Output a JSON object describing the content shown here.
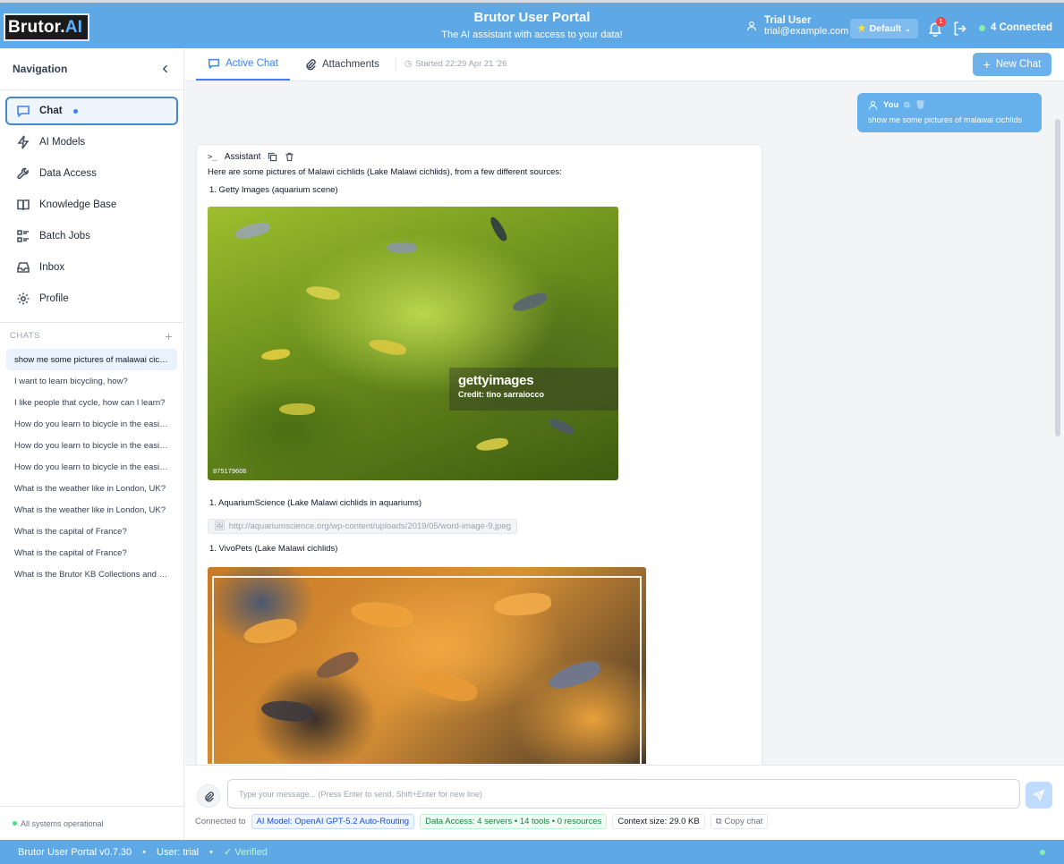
{
  "header": {
    "logo_text": "Brutor.",
    "logo_accent": "AI",
    "title": "Brutor User Portal",
    "subtitle": "The AI assistant with access to your data!",
    "user_name": "Trial User",
    "user_email": "trial@example.com",
    "preset_label": "Default",
    "notification_count": "1",
    "connected_label": "4 Connected"
  },
  "sidebar": {
    "title": "Navigation",
    "nav": [
      {
        "label": "Chat",
        "icon": "chat-icon"
      },
      {
        "label": "AI Models",
        "icon": "bolt-icon"
      },
      {
        "label": "Data Access",
        "icon": "wrench-icon"
      },
      {
        "label": "Knowledge Base",
        "icon": "book-icon"
      },
      {
        "label": "Batch Jobs",
        "icon": "list-icon"
      },
      {
        "label": "Inbox",
        "icon": "inbox-icon"
      },
      {
        "label": "Profile",
        "icon": "gear-icon"
      }
    ],
    "chats_heading": "CHATS",
    "chats": [
      "show me some pictures of malawai cichlids",
      "I want to learn bicycling, how?",
      "I like people that cycle, how can I learn?",
      "How do you learn to bicycle in the easiest way?",
      "How do you learn to bicycle in the easiest way?",
      "How do you learn to bicycle in the easiest way?",
      "What is the weather like in London, UK?",
      "What is the weather like in London, UK?",
      "What is the capital of France?",
      "What is the capital of France?",
      "What is the Brutor KB Collections and Knowledge?"
    ],
    "status_text": "All systems operational"
  },
  "tabs": {
    "active_chat": "Active Chat",
    "attachments": "Attachments",
    "started": "Started 22:29 Apr 21 '26",
    "new_chat": "New Chat"
  },
  "conversation": {
    "user_label": "You",
    "user_message": "show me some pictures of malawai cichlids",
    "assistant_label": "Assistant",
    "intro": "Here are some pictures of Malawi cichlids (Lake Malawi cichlids), from a few different sources:",
    "item1": "1. Getty Images (aquarium scene)",
    "item2": "1. AquariumScience (Lake Malawi cichlids in aquariums)",
    "item2_link": "http://aquariumscience.org/wp-content/uploads/2019/05/word-image-9.jpeg",
    "item3": "1. VivoPets (Lake Malawi cichlids)",
    "watermark_brand": "gettyimages",
    "watermark_credit": "Credit: tino sarraiocco",
    "photo_id": "875179606"
  },
  "composer": {
    "placeholder": "Type your message... (Press Enter to send, Shift+Enter for new line)",
    "connected_to": "Connected to",
    "model_chip": "AI Model: OpenAI GPT-5.2 Auto-Routing",
    "data_chip": "Data Access: 4 servers • 14 tools • 0 resources",
    "context_chip": "Context size: 29.0 KB",
    "copy_chat": "Copy chat"
  },
  "footer": {
    "version": "Brutor User Portal v0.7.30",
    "user": "User: trial",
    "verified": "✓ Verified"
  },
  "colors": {
    "brand": "#5fa8e6",
    "accent": "#3b82f6",
    "status_ok": "#4ade80"
  }
}
